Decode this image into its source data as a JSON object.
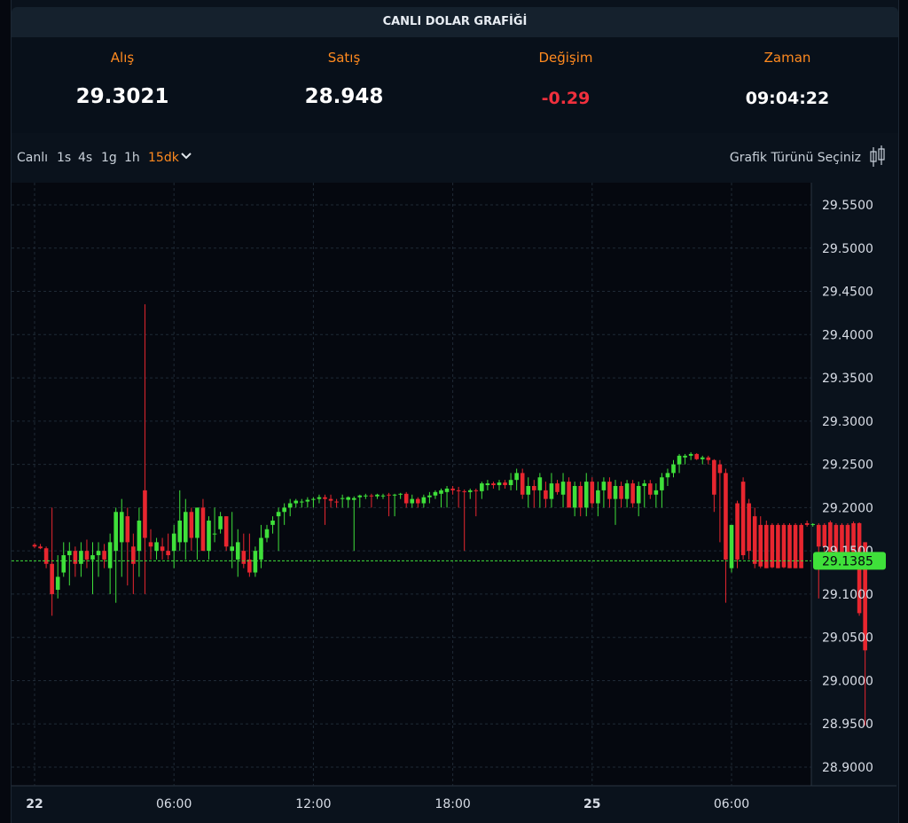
{
  "header": {
    "title": "CANLI DOLAR GRAFİĞİ"
  },
  "stats": [
    {
      "label": "Alış",
      "value": "29.3021"
    },
    {
      "label": "Satış",
      "value": "28.948"
    },
    {
      "label": "Değişim",
      "value": "-0.29"
    },
    {
      "label": "Zaman",
      "value": "09:04:22"
    }
  ],
  "toolbar": {
    "timeframes": [
      "Canlı",
      "1s",
      "4s",
      "1g",
      "1h",
      "15dk"
    ],
    "active_timeframe": "15dk",
    "chart_type_label": "Grafik Türünü Seçiniz",
    "chart_type_icon": "candlestick-icon",
    "dropdown_icon": "chevron-down-icon"
  },
  "colors": {
    "up": "#3fe03a",
    "down": "#e8262f",
    "accent": "#ff8a1f",
    "price_line": "#3fe03a"
  },
  "chart_data": {
    "type": "candlestick",
    "y_ticks": [
      "29.5500",
      "29.5000",
      "29.4500",
      "29.4000",
      "29.3500",
      "29.3000",
      "29.2500",
      "29.2000",
      "29.1500",
      "29.1000",
      "29.0500",
      "29.0000",
      "28.9500",
      "28.9000"
    ],
    "ylim": [
      28.885,
      29.575
    ],
    "x_ticks": [
      {
        "label": "22",
        "bold": true,
        "bar": 0
      },
      {
        "label": "06:00",
        "bold": false,
        "bar": 24
      },
      {
        "label": "12:00",
        "bold": false,
        "bar": 48
      },
      {
        "label": "18:00",
        "bold": false,
        "bar": 72
      },
      {
        "label": "25",
        "bold": true,
        "bar": 96
      },
      {
        "label": "06:00",
        "bold": false,
        "bar": 120
      }
    ],
    "current_price": 29.1385,
    "current_price_label": "29.1385",
    "grid": true,
    "candles": [
      [
        29.157,
        29.159,
        29.153,
        29.155
      ],
      [
        29.155,
        29.158,
        29.152,
        29.153
      ],
      [
        29.153,
        29.155,
        29.13,
        29.135
      ],
      [
        29.135,
        29.2,
        29.075,
        29.1
      ],
      [
        29.105,
        29.145,
        29.095,
        29.12
      ],
      [
        29.125,
        29.16,
        29.12,
        29.145
      ],
      [
        29.145,
        29.16,
        29.11,
        29.15
      ],
      [
        29.15,
        29.155,
        29.12,
        29.135
      ],
      [
        29.135,
        29.16,
        29.12,
        29.15
      ],
      [
        29.15,
        29.163,
        29.13,
        29.14
      ],
      [
        29.14,
        29.16,
        29.1,
        29.145
      ],
      [
        29.145,
        29.16,
        29.12,
        29.15
      ],
      [
        29.15,
        29.158,
        29.13,
        29.14
      ],
      [
        29.13,
        29.17,
        29.1,
        29.16
      ],
      [
        29.15,
        29.2,
        29.09,
        29.195
      ],
      [
        29.16,
        29.21,
        29.12,
        29.195
      ],
      [
        29.19,
        29.2,
        29.11,
        29.16
      ],
      [
        29.155,
        29.17,
        29.1,
        29.135
      ],
      [
        29.15,
        29.2,
        29.12,
        29.185
      ],
      [
        29.22,
        29.435,
        29.1,
        29.165
      ],
      [
        29.16,
        29.175,
        29.14,
        29.155
      ],
      [
        29.15,
        29.165,
        29.14,
        29.16
      ],
      [
        29.155,
        29.165,
        29.14,
        29.15
      ],
      [
        29.15,
        29.17,
        29.14,
        29.145
      ],
      [
        29.15,
        29.18,
        29.13,
        29.17
      ],
      [
        29.16,
        29.22,
        29.15,
        29.185
      ],
      [
        29.16,
        29.21,
        29.14,
        29.195
      ],
      [
        29.195,
        29.2,
        29.15,
        29.165
      ],
      [
        29.165,
        29.2,
        29.14,
        29.2
      ],
      [
        29.2,
        29.21,
        29.15,
        29.15
      ],
      [
        29.15,
        29.19,
        29.14,
        29.185
      ],
      [
        29.17,
        29.2,
        29.16,
        29.17
      ],
      [
        29.175,
        29.195,
        29.17,
        29.19
      ],
      [
        29.19,
        29.19,
        29.15,
        29.155
      ],
      [
        29.15,
        29.195,
        29.13,
        29.155
      ],
      [
        29.14,
        29.175,
        29.12,
        29.16
      ],
      [
        29.15,
        29.17,
        29.13,
        29.135
      ],
      [
        29.14,
        29.17,
        29.12,
        29.125
      ],
      [
        29.125,
        29.155,
        29.12,
        29.15
      ],
      [
        29.14,
        29.18,
        29.13,
        29.165
      ],
      [
        29.165,
        29.18,
        29.16,
        29.175
      ],
      [
        29.18,
        29.19,
        29.17,
        29.185
      ],
      [
        29.19,
        29.2,
        29.15,
        29.195
      ],
      [
        29.195,
        29.205,
        29.18,
        29.2
      ],
      [
        29.2,
        29.21,
        29.19,
        29.205
      ],
      [
        29.205,
        29.21,
        29.2,
        29.208
      ],
      [
        29.206,
        29.21,
        29.2,
        29.207
      ],
      [
        29.207,
        29.212,
        29.2,
        29.209
      ],
      [
        29.209,
        29.212,
        29.2,
        29.21
      ],
      [
        29.21,
        29.215,
        29.205,
        29.212
      ],
      [
        29.212,
        29.215,
        29.18,
        29.21
      ],
      [
        29.21,
        29.215,
        29.2,
        29.208
      ],
      [
        29.207,
        29.21,
        29.2,
        29.206
      ],
      [
        29.21,
        29.215,
        29.2,
        29.211
      ],
      [
        29.209,
        29.213,
        29.2,
        29.212
      ],
      [
        29.209,
        29.213,
        29.15,
        29.211
      ],
      [
        29.212,
        29.215,
        29.2,
        29.214
      ],
      [
        29.214,
        29.216,
        29.21,
        29.214
      ],
      [
        29.214,
        29.216,
        29.2,
        29.213
      ],
      [
        29.213,
        29.216,
        29.21,
        29.215
      ],
      [
        29.213,
        29.216,
        29.21,
        29.214
      ],
      [
        29.215,
        29.217,
        29.19,
        29.214
      ],
      [
        29.214,
        29.216,
        29.19,
        29.215
      ],
      [
        29.215,
        29.217,
        29.21,
        29.216
      ],
      [
        29.216,
        29.218,
        29.2,
        29.205
      ],
      [
        29.205,
        29.215,
        29.2,
        29.21
      ],
      [
        29.21,
        29.212,
        29.2,
        29.205
      ],
      [
        29.205,
        29.215,
        29.2,
        29.212
      ],
      [
        29.212,
        29.218,
        29.205,
        29.214
      ],
      [
        29.214,
        29.22,
        29.21,
        29.218
      ],
      [
        29.216,
        29.222,
        29.2,
        29.22
      ],
      [
        29.218,
        29.225,
        29.2,
        29.222
      ],
      [
        29.222,
        29.225,
        29.215,
        29.22
      ],
      [
        29.22,
        29.224,
        29.2,
        29.219
      ],
      [
        29.219,
        29.221,
        29.15,
        29.218
      ],
      [
        29.218,
        29.222,
        29.21,
        29.22
      ],
      [
        29.22,
        29.222,
        29.19,
        29.219
      ],
      [
        29.219,
        29.23,
        29.21,
        29.228
      ],
      [
        29.226,
        29.232,
        29.22,
        29.228
      ],
      [
        29.228,
        29.23,
        29.222,
        29.226
      ],
      [
        29.226,
        29.232,
        29.22,
        29.229
      ],
      [
        29.229,
        29.232,
        29.222,
        29.226
      ],
      [
        29.226,
        29.24,
        29.22,
        29.232
      ],
      [
        29.232,
        29.245,
        29.22,
        29.24
      ],
      [
        29.24,
        29.245,
        29.21,
        29.215
      ],
      [
        29.215,
        29.235,
        29.2,
        29.225
      ],
      [
        29.225,
        29.232,
        29.2,
        29.22
      ],
      [
        29.22,
        29.24,
        29.2,
        29.235
      ],
      [
        29.22,
        29.23,
        29.2,
        29.21
      ],
      [
        29.21,
        29.24,
        29.2,
        29.228
      ],
      [
        29.228,
        29.232,
        29.215,
        29.218
      ],
      [
        29.215,
        29.24,
        29.2,
        29.23
      ],
      [
        29.23,
        29.235,
        29.2,
        29.2
      ],
      [
        29.2,
        29.23,
        29.19,
        29.225
      ],
      [
        29.225,
        29.23,
        29.19,
        29.2
      ],
      [
        29.2,
        29.24,
        29.19,
        29.23
      ],
      [
        29.23,
        29.235,
        29.2,
        29.205
      ],
      [
        29.205,
        29.23,
        29.19,
        29.22
      ],
      [
        29.22,
        29.235,
        29.2,
        29.23
      ],
      [
        29.23,
        29.235,
        29.2,
        29.21
      ],
      [
        29.21,
        29.232,
        29.18,
        29.225
      ],
      [
        29.225,
        29.23,
        29.2,
        29.21
      ],
      [
        29.21,
        29.232,
        29.2,
        29.228
      ],
      [
        29.228,
        29.232,
        29.2,
        29.205
      ],
      [
        29.205,
        29.23,
        29.19,
        29.225
      ],
      [
        29.225,
        29.232,
        29.2,
        29.228
      ],
      [
        29.228,
        29.232,
        29.21,
        29.215
      ],
      [
        29.215,
        29.228,
        29.2,
        29.22
      ],
      [
        29.22,
        29.24,
        29.2,
        29.235
      ],
      [
        29.235,
        29.245,
        29.225,
        29.24
      ],
      [
        29.24,
        29.255,
        29.235,
        29.25
      ],
      [
        29.25,
        29.262,
        29.24,
        29.26
      ],
      [
        29.258,
        29.262,
        29.25,
        29.26
      ],
      [
        29.26,
        29.264,
        29.255,
        29.262
      ],
      [
        29.262,
        29.263,
        29.255,
        29.256
      ],
      [
        29.256,
        29.26,
        29.25,
        29.258
      ],
      [
        29.258,
        29.26,
        29.25,
        29.255
      ],
      [
        29.255,
        29.256,
        29.195,
        29.215
      ],
      [
        29.25,
        29.255,
        29.16,
        29.24
      ],
      [
        29.24,
        29.245,
        29.09,
        29.14
      ],
      [
        29.13,
        29.18,
        29.125,
        29.18
      ],
      [
        29.205,
        29.208,
        29.13,
        29.14
      ],
      [
        29.23,
        29.235,
        29.14,
        29.145
      ],
      [
        29.205,
        29.21,
        29.14,
        29.15
      ],
      [
        29.19,
        29.2,
        29.13,
        29.135
      ],
      [
        29.18,
        29.19,
        29.13,
        29.132
      ],
      [
        29.18,
        29.185,
        29.13,
        29.13
      ],
      [
        29.18,
        29.182,
        29.13,
        29.131
      ],
      [
        29.18,
        29.182,
        29.13,
        29.13
      ],
      [
        29.18,
        29.182,
        29.13,
        29.131
      ],
      [
        29.18,
        29.182,
        29.13,
        29.13
      ],
      [
        29.18,
        29.182,
        29.13,
        29.13
      ],
      [
        29.18,
        29.182,
        29.13,
        29.13
      ],
      [
        29.182,
        29.185,
        29.178,
        29.18
      ],
      [
        29.18,
        29.182,
        29.178,
        29.181
      ],
      [
        29.18,
        29.182,
        29.095,
        29.155
      ],
      [
        29.18,
        29.182,
        29.14,
        29.155
      ],
      [
        29.183,
        29.185,
        29.13,
        29.13
      ],
      [
        29.18,
        29.182,
        29.13,
        29.13
      ],
      [
        29.18,
        29.182,
        29.13,
        29.131
      ],
      [
        29.18,
        29.182,
        29.13,
        29.13
      ],
      [
        29.182,
        29.184,
        29.13,
        29.13
      ],
      [
        29.182,
        29.183,
        29.075,
        29.078
      ],
      [
        29.16,
        29.16,
        28.948,
        29.035
      ]
    ]
  }
}
